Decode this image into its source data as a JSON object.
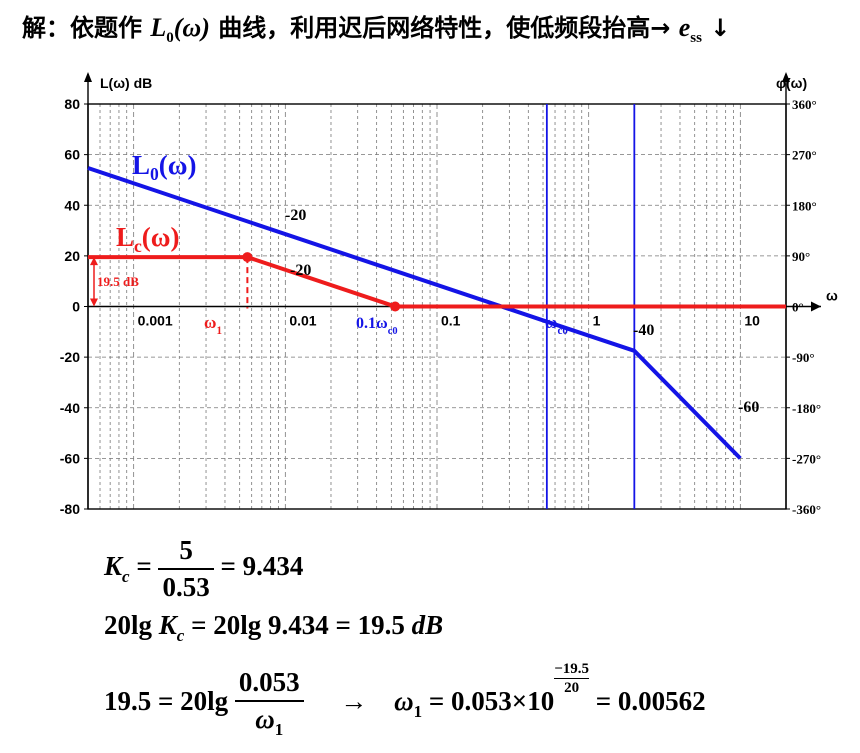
{
  "heading": {
    "prefix": "解：依题作",
    "L": "L",
    "L_sub": "0",
    "omega": "(ω)",
    "rest": "曲线，利用迟后网络特性，使低频段抬高→",
    "e": "e",
    "e_sub": "ss",
    "down": "↓"
  },
  "chart_data": {
    "type": "line",
    "x_scale": "log",
    "xlim": [
      0.0005,
      20
    ],
    "ylim": [
      -80,
      80
    ],
    "left_axis_label": "L(ω) dB",
    "right_axis_label": "φ(ω)",
    "x_axis_symbol": "ω",
    "y_ticks": [
      80,
      60,
      40,
      20,
      0,
      -20,
      -40,
      -60,
      -80
    ],
    "phase_ticks": [
      "360°",
      "270°",
      "180°",
      "90°",
      "0°",
      "-90°",
      "-180°",
      "-270°",
      "-360°"
    ],
    "x_tick_labels": [
      {
        "x": 0.001,
        "text": "0.001"
      },
      {
        "x": 0.01,
        "text": "0.01"
      },
      {
        "x": 0.1,
        "text": "0.1"
      },
      {
        "x": 1,
        "text": "1"
      },
      {
        "x": 10,
        "text": "10"
      }
    ],
    "grid": true,
    "series": [
      {
        "name": "L0(ω)",
        "color": "#1414e6",
        "points": [
          [
            0.0005,
            54.7
          ],
          [
            0.53,
            -6
          ],
          [
            2,
            -17.5
          ],
          [
            10,
            -60
          ]
        ]
      },
      {
        "name": "Lc(ω)",
        "color": "#ee1c1c",
        "points": [
          [
            0.0005,
            19.5
          ],
          [
            0.00562,
            19.5
          ],
          [
            0.053,
            0
          ],
          [
            20,
            0
          ]
        ]
      }
    ],
    "vertical_lines": [
      0.53,
      2
    ],
    "markers": [
      [
        0.00562,
        19.5
      ],
      [
        0.053,
        0
      ]
    ],
    "annotations": {
      "L0_label": "L",
      "L0_sub": "0",
      "L0_suffix": "(ω)",
      "Lc_label": "L",
      "Lc_sub": "c",
      "Lc_suffix": "(ω)",
      "slope_L0_a": "-20",
      "slope_Lc": "-20",
      "slope_b": "-40",
      "slope_c": "-60",
      "gain_mark": "19.5 dB",
      "omega1": "ω",
      "omega1_sub": "1",
      "wc0_prefix": "0.1",
      "wc0": "ω",
      "wc0_sub": "c0",
      "wc": "ω",
      "wc_sub": "c0"
    }
  },
  "formulas": {
    "f1": {
      "lhs": "K",
      "lhs_sub": "c",
      "num": "5",
      "den": "0.53",
      "rhs": "= 9.434"
    },
    "f2": {
      "a": "20lg",
      "K": "K",
      "K_sub": "c",
      "b": "= 20lg 9.434 = 19.5",
      "unit": "dB"
    },
    "f3": {
      "a": "19.5 = 20lg",
      "num": "0.053",
      "den": "ω",
      "den_sub": "1",
      "arrow": "→",
      "w": "ω",
      "w_sub": "1",
      "b": "= 0.053×10",
      "exp_num": "−19.5",
      "exp_den": "20",
      "c": "= 0.00562"
    }
  }
}
